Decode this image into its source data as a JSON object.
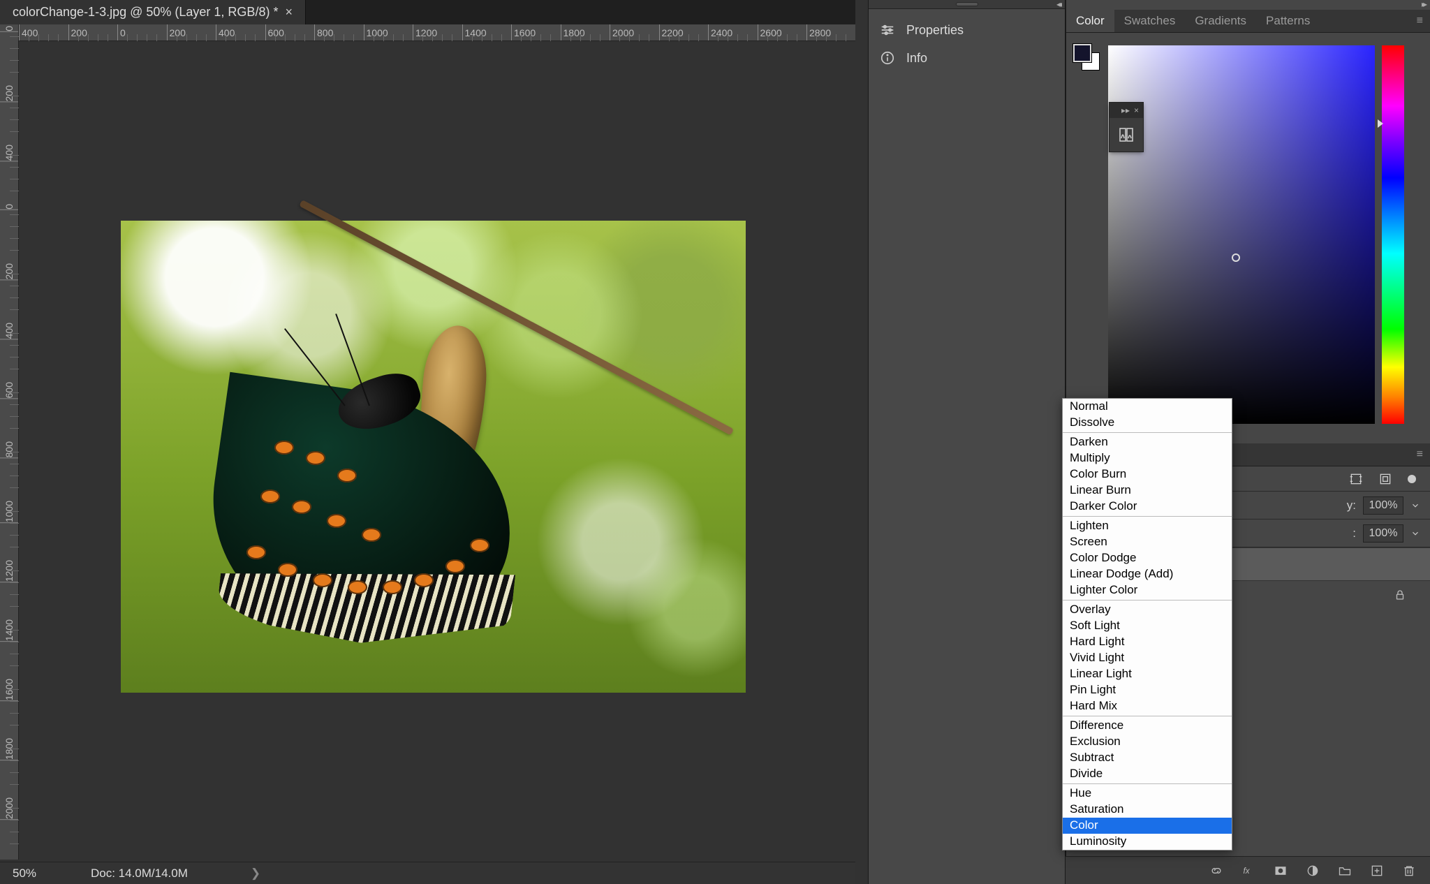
{
  "document": {
    "tab_title": "colorChange-1-3.jpg @ 50% (Layer 1, RGB/8) *"
  },
  "ruler": {
    "h_ticks": [
      "400",
      "200",
      "0",
      "200",
      "400",
      "600",
      "800",
      "1000",
      "1200",
      "1400",
      "1600",
      "1800",
      "2000",
      "2200",
      "2400",
      "2600",
      "2800"
    ],
    "v_ticks": [
      "0",
      "200",
      "400",
      "0",
      "200",
      "400",
      "600",
      "800",
      "1000",
      "1200",
      "1400",
      "1600",
      "1800",
      "2000"
    ]
  },
  "statusbar": {
    "zoom": "50%",
    "doc_info": "Doc: 14.0M/14.0M"
  },
  "mid_dock": {
    "properties": "Properties",
    "info": "Info"
  },
  "color_panel": {
    "tabs": [
      "Color",
      "Swatches",
      "Gradients",
      "Patterns"
    ],
    "active_tab": 0,
    "fg_hex": "#14142c",
    "bg_hex": "#ffffff"
  },
  "layers_panel": {
    "opacity_label_suffix": "y:",
    "opacity_value": "100%",
    "fill_label_suffix": ":",
    "fill_value": "100%"
  },
  "blend_modes": {
    "groups": [
      [
        "Normal",
        "Dissolve"
      ],
      [
        "Darken",
        "Multiply",
        "Color Burn",
        "Linear Burn",
        "Darker Color"
      ],
      [
        "Lighten",
        "Screen",
        "Color Dodge",
        "Linear Dodge (Add)",
        "Lighter Color"
      ],
      [
        "Overlay",
        "Soft Light",
        "Hard Light",
        "Vivid Light",
        "Linear Light",
        "Pin Light",
        "Hard Mix"
      ],
      [
        "Difference",
        "Exclusion",
        "Subtract",
        "Divide"
      ],
      [
        "Hue",
        "Saturation",
        "Color",
        "Luminosity"
      ]
    ],
    "selected": "Color"
  }
}
